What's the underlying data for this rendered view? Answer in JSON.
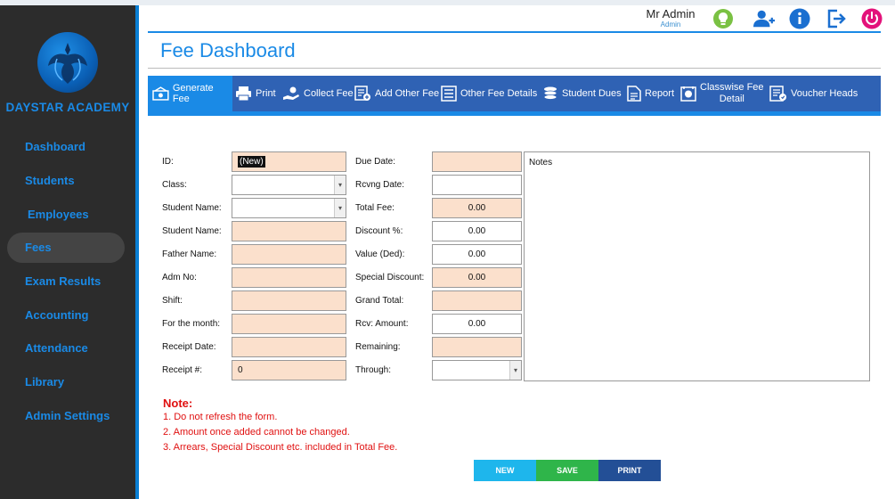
{
  "sidebar": {
    "brand": "DAYSTAR ACADEMY",
    "items": [
      {
        "label": "Dashboard"
      },
      {
        "label": "Students"
      },
      {
        "label": "Employees"
      },
      {
        "label": "Fees"
      },
      {
        "label": "Exam Results"
      },
      {
        "label": "Accounting"
      },
      {
        "label": "Attendance"
      },
      {
        "label": "Library"
      },
      {
        "label": "Admin Settings"
      }
    ],
    "active_item": "Fees"
  },
  "user": {
    "name": "Mr Admin",
    "role": "Admin"
  },
  "top_icons": [
    "lightbulb-icon",
    "add-user-icon",
    "info-icon",
    "logout-icon",
    "power-icon"
  ],
  "page": {
    "title": "Fee Dashboard"
  },
  "toolbar": {
    "generate_fee": "Generate Fee",
    "print": "Print",
    "collect_fee": "Collect Fee",
    "add_other_fee": "Add Other Fee",
    "other_fee_details": "Other Fee Details",
    "student_dues": "Student Dues",
    "report": "Report",
    "classwise_line1": "Classwise Fee",
    "classwise_line2": "Detail",
    "voucher_heads": "Voucher Heads",
    "active": "Generate Fee"
  },
  "form": {
    "id_label": "ID:",
    "id_value": "(New)",
    "class_label": "Class:",
    "student_name_select_label": "Student Name:",
    "student_name_label": "Student Name:",
    "father_name_label": "Father Name:",
    "adm_no_label": "Adm No:",
    "shift_label": "Shift:",
    "month_label": "For the month:",
    "receipt_date_label": "Receipt Date:",
    "receipt_no_label": "Receipt #:",
    "receipt_no_value": "0",
    "due_date_label": "Due Date:",
    "rcvng_date_label": "Rcvng Date:",
    "total_fee_label": "Total Fee:",
    "total_fee_value": "0.00",
    "discount_label": "Discount %:",
    "discount_value": "0.00",
    "value_ded_label": "Value (Ded):",
    "value_ded_value": "0.00",
    "special_discount_label": "Special Discount:",
    "special_discount_value": "0.00",
    "grand_total_label": "Grand Total:",
    "rcv_amount_label": "Rcv: Amount:",
    "rcv_amount_value": "0.00",
    "remaining_label": "Remaining:",
    "through_label": "Through:",
    "notes_label": "Notes"
  },
  "notes": {
    "title": "Note:",
    "lines": [
      "1. Do not refresh the form.",
      "2. Amount once added cannot be changed.",
      "3. Arrears, Special Discount etc. included in Total Fee."
    ]
  },
  "actions": {
    "new": "NEW",
    "save": "SAVE",
    "print": "PRINT"
  },
  "colors": {
    "accent": "#1a8ae6",
    "toolbar": "#2f62b4",
    "field_fill": "#fbe0cc",
    "new_button": "#1eb6ec",
    "save_button": "#2fb54a",
    "print_button": "#234f96",
    "note_text": "#e01010"
  }
}
